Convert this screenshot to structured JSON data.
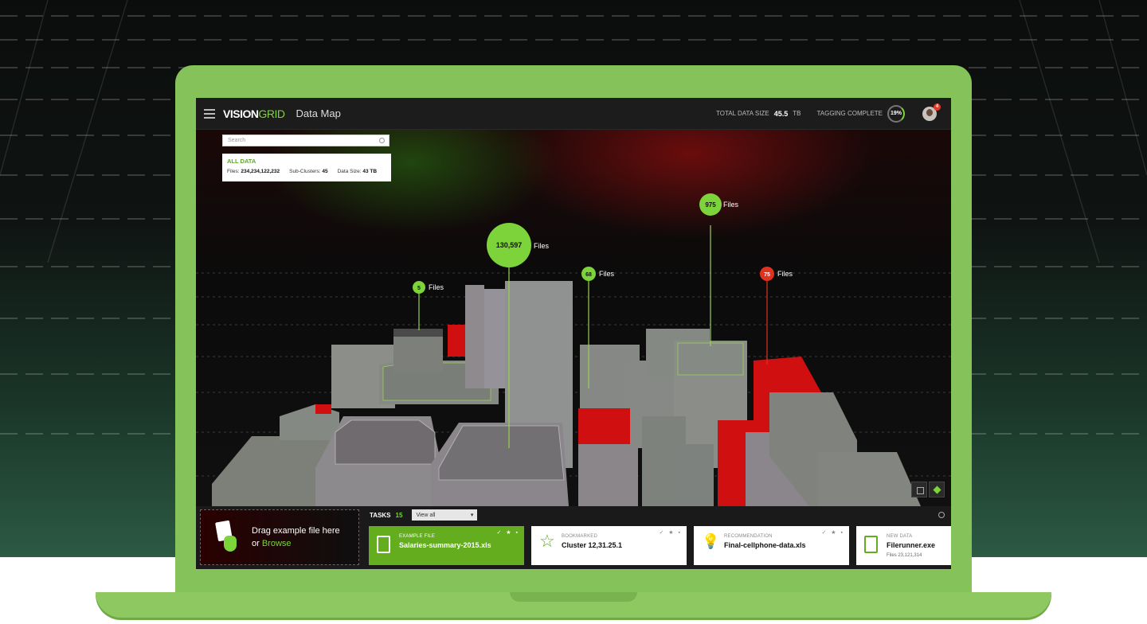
{
  "header": {
    "logo_part1": "VISION",
    "logo_part2": "GRID",
    "title": "Data Map",
    "total_data_size_label": "TOTAL DATA SIZE",
    "total_data_size_value": "45.5",
    "total_data_size_unit": "TB",
    "tagging_label": "TAGGING COMPLETE",
    "tagging_value": "19%",
    "notification_count": "4"
  },
  "search": {
    "placeholder": "Search"
  },
  "summary": {
    "title": "ALL DATA",
    "files_label": "Files:",
    "files_value": "234,234,122,232",
    "subclusters_label": "Sub-Clusters:",
    "subclusters_value": "45",
    "datasize_label": "Data Size:",
    "datasize_value": "43 TB"
  },
  "pins": [
    {
      "count": "130,597",
      "label": "Files",
      "color": "#7dd33a"
    },
    {
      "count": "975",
      "label": "Files",
      "color": "#7dd33a"
    },
    {
      "count": "68",
      "label": "Files",
      "color": "#7dd33a"
    },
    {
      "count": "75",
      "label": "Files",
      "color": "#e0321f"
    },
    {
      "count": "5",
      "label": "Files",
      "color": "#7dd33a"
    }
  ],
  "dropzone": {
    "line1": "Drag example file here",
    "or": "or",
    "browse": "Browse"
  },
  "tasks": {
    "label": "TASKS",
    "count": "15",
    "filter": "View all",
    "cards": [
      {
        "kind": "EXAMPLE FILE",
        "name": "Salaries-summary-2015.xls",
        "icon": "file-icon"
      },
      {
        "kind": "BOOKMARKED",
        "name": "Cluster 12,31.25.1",
        "icon": "star-icon"
      },
      {
        "kind": "RECOMMENDATION",
        "name": "Final-cellphone-data.xls",
        "icon": "lightbulb-icon"
      },
      {
        "kind": "NEW DATA",
        "name": "Filerunner.exe",
        "meta_label": "Files",
        "meta_value": "23,121,314",
        "icon": "new-file-icon"
      }
    ]
  },
  "colors": {
    "accent": "#7dd33a",
    "alert": "#e0321f",
    "laptop": "#86c25a"
  }
}
